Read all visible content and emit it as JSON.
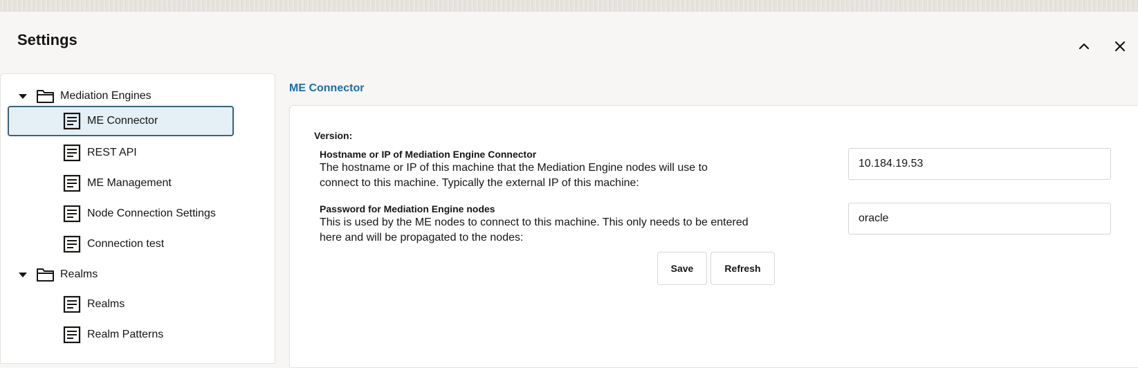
{
  "header": {
    "title": "Settings",
    "collapse_icon": "chevron-up-icon",
    "close_icon": "close-icon"
  },
  "sidebar": {
    "groups": [
      {
        "label": "Mediation Engines",
        "expanded": true,
        "items": [
          {
            "label": "ME Connector",
            "selected": true
          },
          {
            "label": "REST API"
          },
          {
            "label": "ME Management"
          },
          {
            "label": "Node Connection Settings"
          },
          {
            "label": "Connection test"
          }
        ]
      },
      {
        "label": "Realms",
        "expanded": true,
        "items": [
          {
            "label": "Realms"
          },
          {
            "label": "Realm Patterns"
          }
        ]
      }
    ]
  },
  "main": {
    "section_title": "ME Connector",
    "version_label": "Version:",
    "fields": [
      {
        "title": "Hostname or IP of Mediation Engine Connector",
        "description": "The hostname or IP of this machine that the Mediation Engine nodes will use to connect to this machine. Typically the external IP of this machine:",
        "value": "10.184.19.53"
      },
      {
        "title": "Password for Mediation Engine nodes",
        "description": "This is used by the ME nodes to connect to this machine. This only needs to be entered here and will be propagated to the nodes:",
        "value": "oracle"
      }
    ],
    "buttons": {
      "save": "Save",
      "refresh": "Refresh"
    }
  },
  "colors": {
    "accent": "#1a6ea8",
    "selected_bg": "#e4eff6",
    "selected_border": "#3b6178"
  }
}
